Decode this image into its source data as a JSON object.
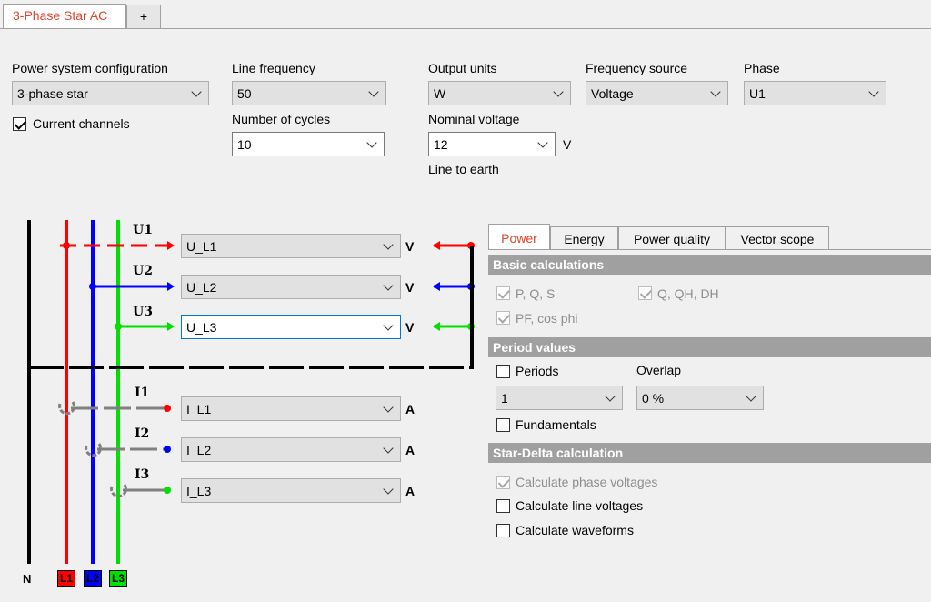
{
  "tabs": {
    "active": "3-Phase Star AC",
    "add": "+"
  },
  "config": {
    "power_system": {
      "label": "Power system configuration",
      "value": "3-phase star"
    },
    "current_channels": {
      "label": "Current channels",
      "checked": true
    },
    "line_frequency": {
      "label": "Line frequency",
      "value": "50"
    },
    "number_of_cycles": {
      "label": "Number of cycles",
      "value": "10"
    },
    "output_units": {
      "label": "Output units",
      "value": "W"
    },
    "nominal_voltage": {
      "label": "Nominal voltage",
      "value": "12",
      "unit": "V",
      "note": "Line to earth"
    },
    "frequency_source": {
      "label": "Frequency source",
      "value": "Voltage"
    },
    "phase": {
      "label": "Phase",
      "value": "U1"
    }
  },
  "diagram": {
    "voltage_channels": [
      {
        "label": "U1",
        "value": "U_L1",
        "unit": "V",
        "color": "#ff0000"
      },
      {
        "label": "U2",
        "value": "U_L2",
        "unit": "V",
        "color": "#0000ff"
      },
      {
        "label": "U3",
        "value": "U_L3",
        "unit": "V",
        "color": "#00e000"
      }
    ],
    "current_channels": [
      {
        "label": "I1",
        "value": "I_L1",
        "unit": "A",
        "color": "#ff0000"
      },
      {
        "label": "I2",
        "value": "I_L2",
        "unit": "A",
        "color": "#0000ff"
      },
      {
        "label": "I3",
        "value": "I_L3",
        "unit": "A",
        "color": "#00e000"
      }
    ],
    "lines": [
      {
        "label": "N",
        "color": "#000000"
      },
      {
        "label": "L1",
        "color": "#ff0000"
      },
      {
        "label": "L2",
        "color": "#0000ff"
      },
      {
        "label": "L3",
        "color": "#00e000"
      }
    ]
  },
  "right_tabs": [
    "Power",
    "Energy",
    "Power quality",
    "Vector scope"
  ],
  "basic_calculations": {
    "title": "Basic calculations",
    "items": [
      {
        "label": "P, Q, S",
        "checked": true,
        "disabled": true
      },
      {
        "label": "Q, QH, DH",
        "checked": true,
        "disabled": true
      },
      {
        "label": "PF, cos phi",
        "checked": true,
        "disabled": true
      }
    ]
  },
  "period_values": {
    "title": "Period values",
    "periods": {
      "label": "Periods",
      "checked": false,
      "value": "1"
    },
    "overlap": {
      "label": "Overlap",
      "value": "0 %"
    },
    "fundamentals": {
      "label": "Fundamentals",
      "checked": false
    }
  },
  "star_delta": {
    "title": "Star-Delta calculation",
    "items": [
      {
        "label": "Calculate phase voltages",
        "checked": true,
        "disabled": true
      },
      {
        "label": "Calculate line voltages",
        "checked": false,
        "disabled": false
      },
      {
        "label": "Calculate waveforms",
        "checked": false,
        "disabled": false
      }
    ]
  }
}
